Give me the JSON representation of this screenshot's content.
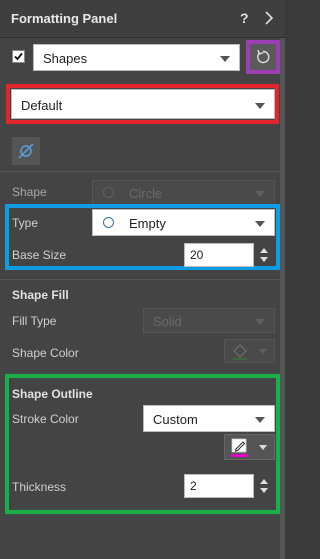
{
  "header": {
    "title": "Formatting Panel",
    "help": "?"
  },
  "top": {
    "checkbox_checked": true,
    "object_select": "Shapes"
  },
  "preset": {
    "value": "Default"
  },
  "shape_row": {
    "label": "Shape",
    "value": "Circle"
  },
  "type_row": {
    "label": "Type",
    "value": "Empty"
  },
  "size_row": {
    "label": "Base Size",
    "value": "20"
  },
  "fill": {
    "title": "Shape Fill",
    "type_label": "Fill Type",
    "type_value": "Solid",
    "color_label": "Shape Color"
  },
  "outline": {
    "title": "Shape Outline",
    "stroke_label": "Stroke Color",
    "stroke_value": "Custom",
    "thickness_label": "Thickness",
    "thickness_value": "2"
  },
  "colors": {
    "purple": "#9c3fb5",
    "red": "#e4242d",
    "blue": "#0e9de3",
    "green": "#17b04a",
    "accent": "#5aa0e0",
    "swatch": "#e600c8"
  }
}
